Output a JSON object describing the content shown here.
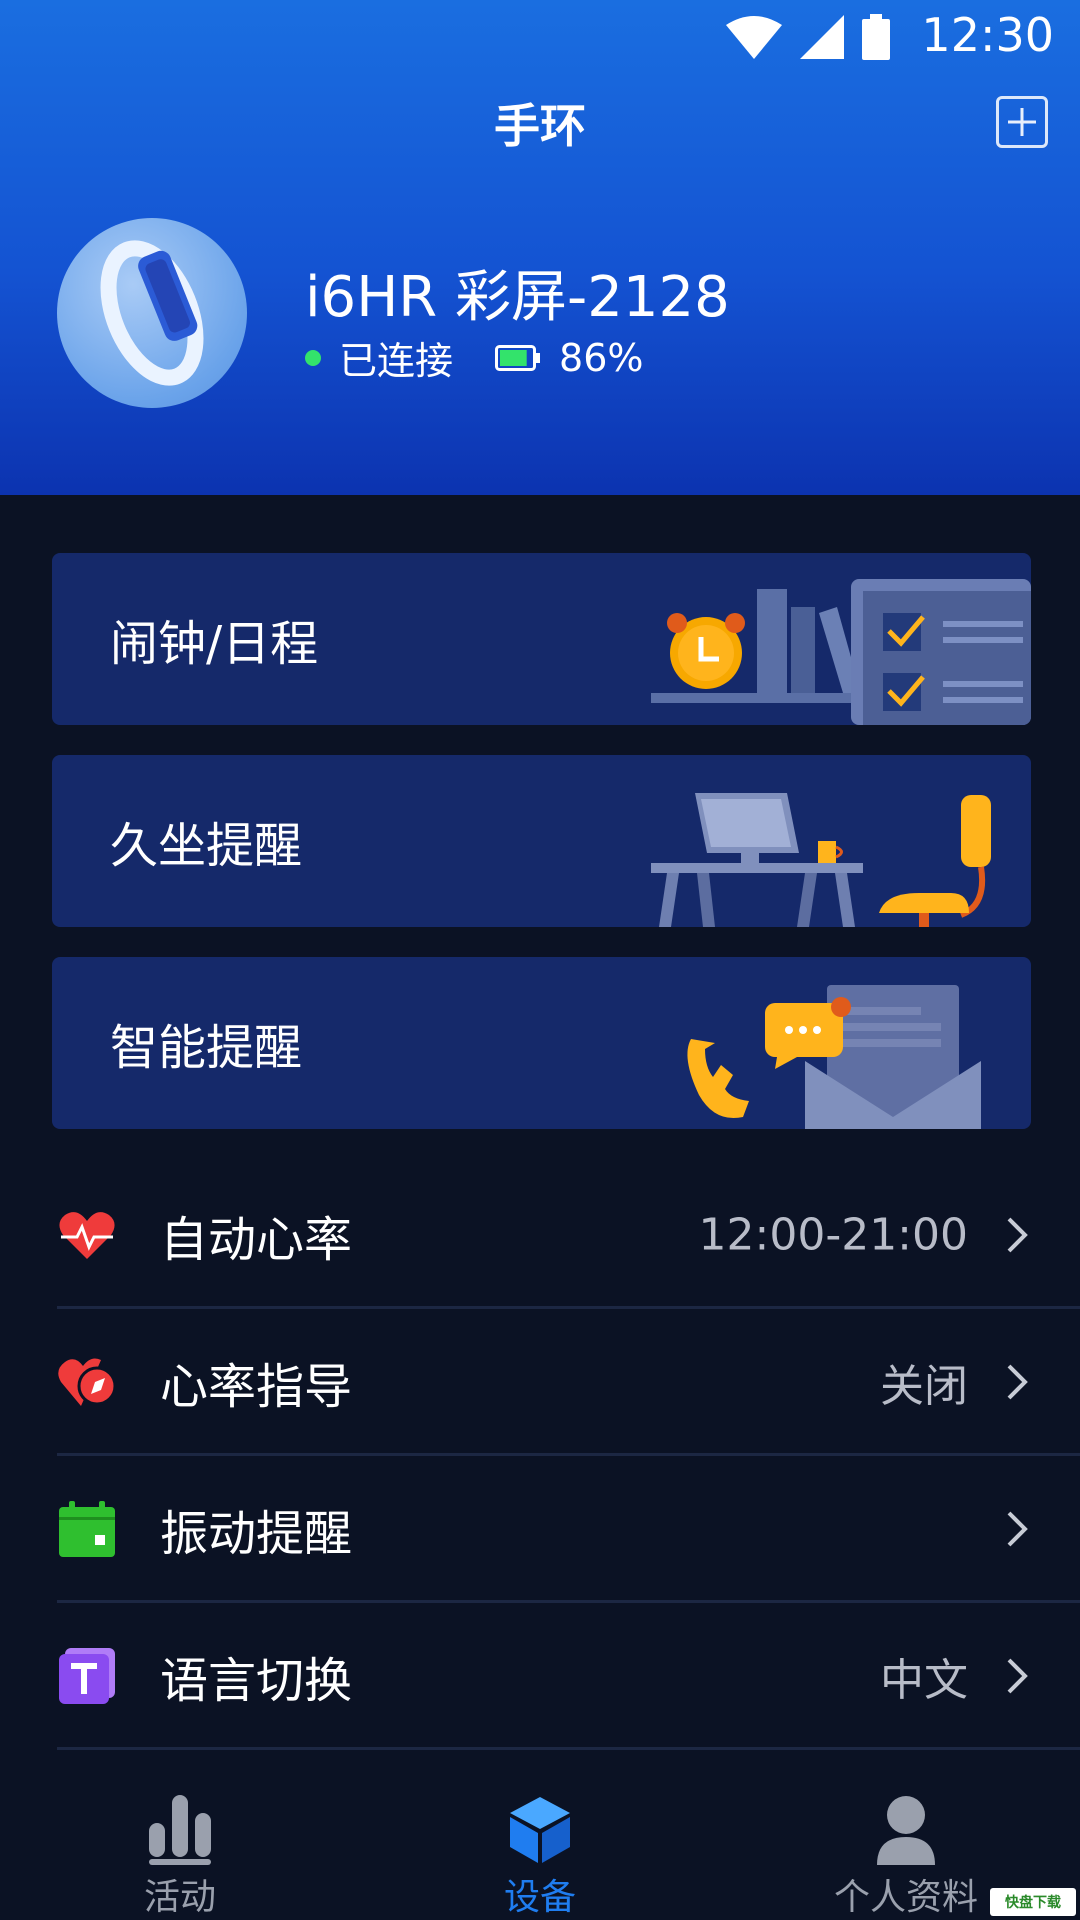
{
  "status_bar": {
    "time": "12:30",
    "icons": [
      "wifi-icon",
      "signal-icon",
      "battery-icon"
    ]
  },
  "header": {
    "title": "手环",
    "add_icon": "plus-square-icon",
    "device": {
      "name": "i6HR 彩屏-2128",
      "connection": "已连接",
      "battery": "86%",
      "battery_level": 0.86
    }
  },
  "cards": [
    {
      "label": "闹钟/日程",
      "art": "alarm-schedule-illustration"
    },
    {
      "label": "久坐提醒",
      "art": "desk-chair-illustration"
    },
    {
      "label": "智能提醒",
      "art": "phone-message-illustration"
    }
  ],
  "settings": [
    {
      "label": "自动心率",
      "value": "12:00-21:00",
      "icon": "heart-pulse-icon",
      "color": "#ef3b3b"
    },
    {
      "label": "心率指导",
      "value": "关闭",
      "icon": "heart-compass-icon",
      "color": "#ef3b3b"
    },
    {
      "label": "振动提醒",
      "value": "",
      "icon": "calendar-icon",
      "color": "#2fbf2f"
    },
    {
      "label": "语言切换",
      "value": "中文",
      "icon": "text-icon",
      "color": "#8a4bf0"
    }
  ],
  "nav": [
    {
      "label": "活动",
      "icon": "bar-chart-icon",
      "active": false
    },
    {
      "label": "设备",
      "icon": "cube-icon",
      "active": true
    },
    {
      "label": "个人资料",
      "icon": "person-icon",
      "active": false
    }
  ],
  "watermark": "快盘下载",
  "colors": {
    "header_top": "#1a6ee0",
    "header_bottom": "#0c33b0",
    "background": "#0b1224",
    "card": "#15296a",
    "accent": "#1f7df0",
    "inactive": "#9aa0ad"
  }
}
